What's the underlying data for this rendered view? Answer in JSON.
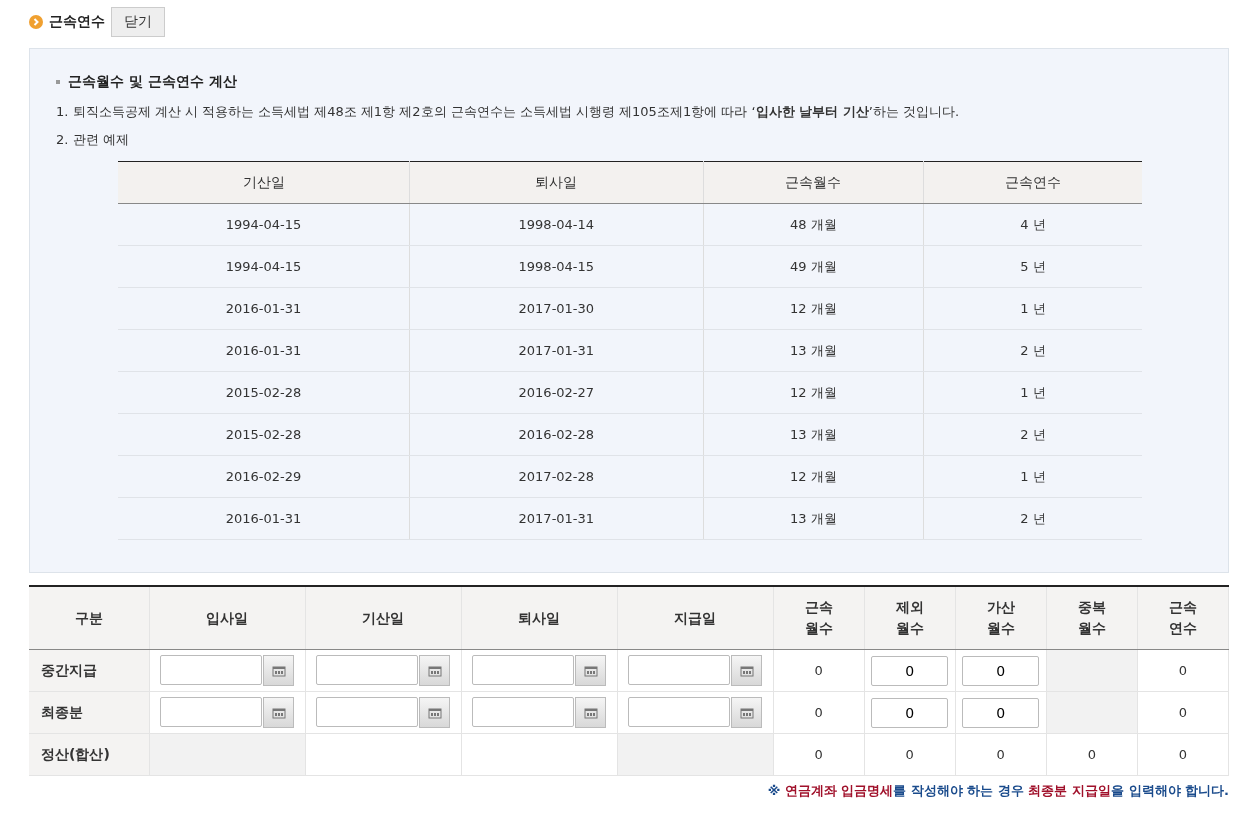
{
  "header": {
    "title": "근속연수",
    "close_button": "닫기"
  },
  "info": {
    "heading": "근속월수 및 근속연수 계산",
    "lines": [
      "1. 퇴직소득공제 계산 시 적용하는 소득세법 제48조 제1항 제2호의 근속연수는 소득세법 시행령 제105조제1항에 따라 ‘**입사한 날부터 기산**’하는 것입니다.",
      "2. 관련 예제"
    ],
    "example_table": {
      "columns": [
        "기산일",
        "퇴사일",
        "근속월수",
        "근속연수"
      ],
      "rows": [
        [
          "1994-04-15",
          "1998-04-14",
          "48 개월",
          "4 년"
        ],
        [
          "1994-04-15",
          "1998-04-15",
          "49 개월",
          "5 년"
        ],
        [
          "2016-01-31",
          "2017-01-30",
          "12 개월",
          "1 년"
        ],
        [
          "2016-01-31",
          "2017-01-31",
          "13 개월",
          "2 년"
        ],
        [
          "2015-02-28",
          "2016-02-27",
          "12 개월",
          "1 년"
        ],
        [
          "2015-02-28",
          "2016-02-28",
          "13 개월",
          "2 년"
        ],
        [
          "2016-02-29",
          "2017-02-28",
          "12 개월",
          "1 년"
        ],
        [
          "2016-01-31",
          "2017-01-31",
          "13 개월",
          "2 년"
        ]
      ]
    }
  },
  "calc_table": {
    "columns": [
      "구분",
      "입사일",
      "기산일",
      "퇴사일",
      "지급일",
      "근속 월수",
      "제외 월수",
      "가산 월수",
      "중복 월수",
      "근속 연수"
    ],
    "rows": [
      {
        "cells": [
          {
            "kind": "label",
            "text": "중간지급"
          },
          {
            "kind": "date"
          },
          {
            "kind": "date"
          },
          {
            "kind": "date"
          },
          {
            "kind": "date"
          },
          {
            "kind": "value",
            "text": "0"
          },
          {
            "kind": "input",
            "value": "0"
          },
          {
            "kind": "input",
            "value": "0"
          },
          {
            "kind": "shaded"
          },
          {
            "kind": "value",
            "text": "0"
          }
        ]
      },
      {
        "cells": [
          {
            "kind": "label",
            "text": "최종분"
          },
          {
            "kind": "date"
          },
          {
            "kind": "date"
          },
          {
            "kind": "date"
          },
          {
            "kind": "date"
          },
          {
            "kind": "value",
            "text": "0"
          },
          {
            "kind": "input",
            "value": "0"
          },
          {
            "kind": "input",
            "value": "0"
          },
          {
            "kind": "shaded"
          },
          {
            "kind": "value",
            "text": "0"
          }
        ]
      },
      {
        "cells": [
          {
            "kind": "label",
            "text": "정산(합산)"
          },
          {
            "kind": "shaded"
          },
          {
            "kind": "blank"
          },
          {
            "kind": "blank"
          },
          {
            "kind": "shaded"
          },
          {
            "kind": "value",
            "text": "0"
          },
          {
            "kind": "value",
            "text": "0"
          },
          {
            "kind": "value",
            "text": "0"
          },
          {
            "kind": "value",
            "text": "0"
          },
          {
            "kind": "value",
            "text": "0"
          }
        ]
      }
    ]
  },
  "footnote": [
    {
      "text": "※ ",
      "kind": "plain"
    },
    {
      "text": "연금계좌 입금명세",
      "kind": "highlight"
    },
    {
      "text": "를 작성해야 하는 경우 ",
      "kind": "plain"
    },
    {
      "text": "최종분 지급일",
      "kind": "highlight"
    },
    {
      "text": "을 입력해야 합니다.",
      "kind": "plain"
    }
  ]
}
